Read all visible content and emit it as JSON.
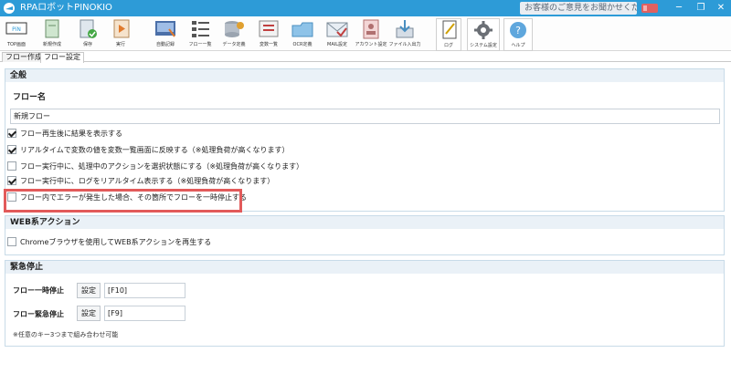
{
  "window": {
    "title": "RPAロボットPINOKIO",
    "feedback_text": "お客様のご意見をお聞かせください",
    "minimize": "─",
    "maximize": "❐",
    "close": "✕"
  },
  "toolbar": {
    "items": [
      {
        "label": "TOP画面",
        "icon": "top-screen-icon"
      },
      {
        "label": "新規作成",
        "icon": "new-file-icon"
      },
      {
        "label": "保存",
        "icon": "save-icon"
      },
      {
        "label": "実行",
        "icon": "run-icon"
      },
      {
        "label": "自動記録",
        "icon": "auto-record-icon"
      },
      {
        "label": "フロー一覧",
        "icon": "flow-list-icon"
      },
      {
        "label": "データ定義",
        "icon": "data-definition-icon"
      },
      {
        "label": "変数一覧",
        "icon": "variable-list-icon"
      },
      {
        "label": "OCR定義",
        "icon": "ocr-icon"
      },
      {
        "label": "MAIL設定",
        "icon": "mail-icon"
      },
      {
        "label": "アカウント設定",
        "icon": "account-icon"
      },
      {
        "label": "ファイル入出力",
        "icon": "file-io-icon"
      },
      {
        "label": "ログ",
        "icon": "log-icon"
      },
      {
        "label": "システム設定",
        "icon": "system-settings-icon"
      },
      {
        "label": "ヘルプ",
        "icon": "help-icon"
      }
    ]
  },
  "tabs": [
    {
      "label": "フロー作成"
    },
    {
      "label": "フロー設定"
    }
  ],
  "general": {
    "heading": "全般",
    "flow_name_label": "フロー名",
    "flow_name_value": "新規フロー",
    "options": [
      {
        "label": "フロー再生後に結果を表示する",
        "checked": true
      },
      {
        "label": "リアルタイムで変数の値を変数一覧画面に反映する（※処理負荷が高くなります）",
        "checked": true
      },
      {
        "label": "フロー実行中に、処理中のアクションを選択状態にする（※処理負荷が高くなります）",
        "checked": false
      },
      {
        "label": "フロー実行中に、ログをリアルタイム表示する（※処理負荷が高くなります）",
        "checked": true
      },
      {
        "label": "フロー内でエラーが発生した場合、その箇所でフローを一時停止する",
        "checked": false
      }
    ]
  },
  "web": {
    "heading": "WEB系アクション",
    "option": {
      "label": "Chromeブラウザを使用してWEB系アクションを再生する",
      "checked": false
    }
  },
  "emergency": {
    "heading": "緊急停止",
    "pause_label": "フロー一時停止",
    "pause_button": "設定",
    "pause_key": "[F10]",
    "stop_label": "フロー緊急停止",
    "stop_button": "設定",
    "stop_key": "[F9]",
    "note": "※任意のキー3つまで組み合わせ可能"
  },
  "colors": {
    "titlebar": "#2d9bd7",
    "highlight": "#e25a5a",
    "panel_header": "#eaf1f7"
  }
}
